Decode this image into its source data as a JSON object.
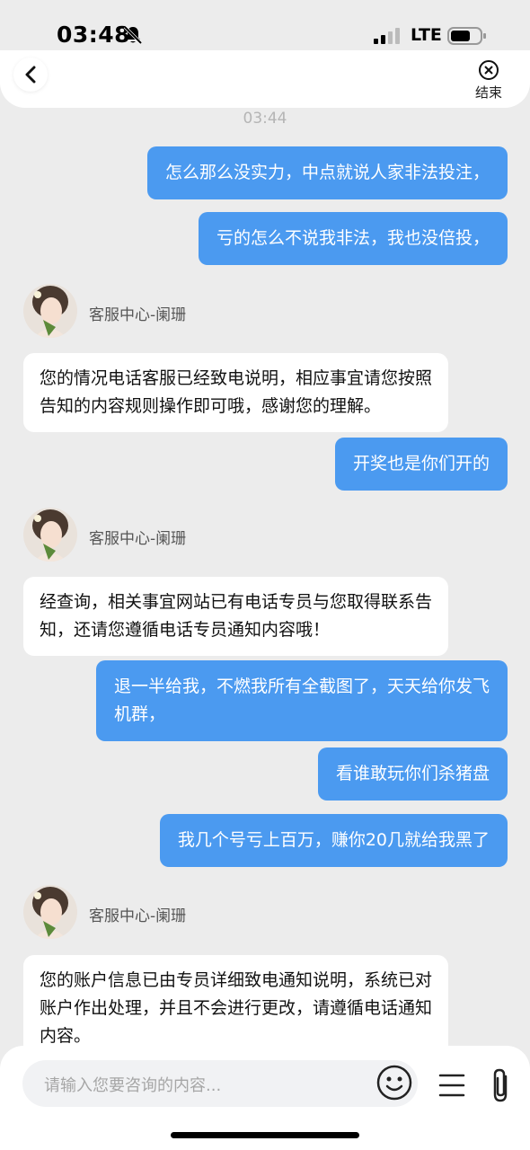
{
  "status_bar": {
    "time": "03:48",
    "network": "LTE",
    "icons": [
      "bell-slash-icon",
      "signal-icon",
      "battery-icon"
    ]
  },
  "header": {
    "back_icon": "chevron-left-icon",
    "end_icon": "close-circle-icon",
    "end_label": "结束"
  },
  "chat": {
    "timestamp": "03:44",
    "messages": [
      {
        "from": "user",
        "text": "怎么那么没实力，中点就说人家非法投注，"
      },
      {
        "from": "user",
        "text": "亏的怎么不说我非法，我也没倍投，"
      },
      {
        "from": "agent",
        "name": "客服中心-阑珊",
        "text": "您的情况电话客服已经致电说明，相应事宜请您按照\n告知的内容规则操作即可哦，感谢您的理解。"
      },
      {
        "from": "user",
        "text": "开奖也是你们开的"
      },
      {
        "from": "agent",
        "name": "客服中心-阑珊",
        "text": "经查询，相关事宜网站已有电话专员与您取得联系告\n知，还请您遵循电话专员通知内容哦！"
      },
      {
        "from": "user",
        "text": "退一半给我，不燃我所有全截图了，天天给你发飞\n机群，"
      },
      {
        "from": "user",
        "text": "看谁敢玩你们杀猪盘"
      },
      {
        "from": "user",
        "text": "我几个号亏上百万，赚你20几就给我黑了"
      },
      {
        "from": "agent",
        "name": "客服中心-阑珊",
        "text": "您的账户信息已由专员详细致电通知说明，系统已对\n账户作出处理，并且不会进行更改，请遵循电话通知\n内容。"
      }
    ]
  },
  "input": {
    "placeholder": "请输入您要咨询的内容...",
    "icons": [
      "emoji-icon",
      "menu-icon",
      "paperclip-icon"
    ]
  },
  "colors": {
    "user_bubble": "#4b9af0",
    "agent_bubble": "#ffffff",
    "background": "#ececec"
  }
}
